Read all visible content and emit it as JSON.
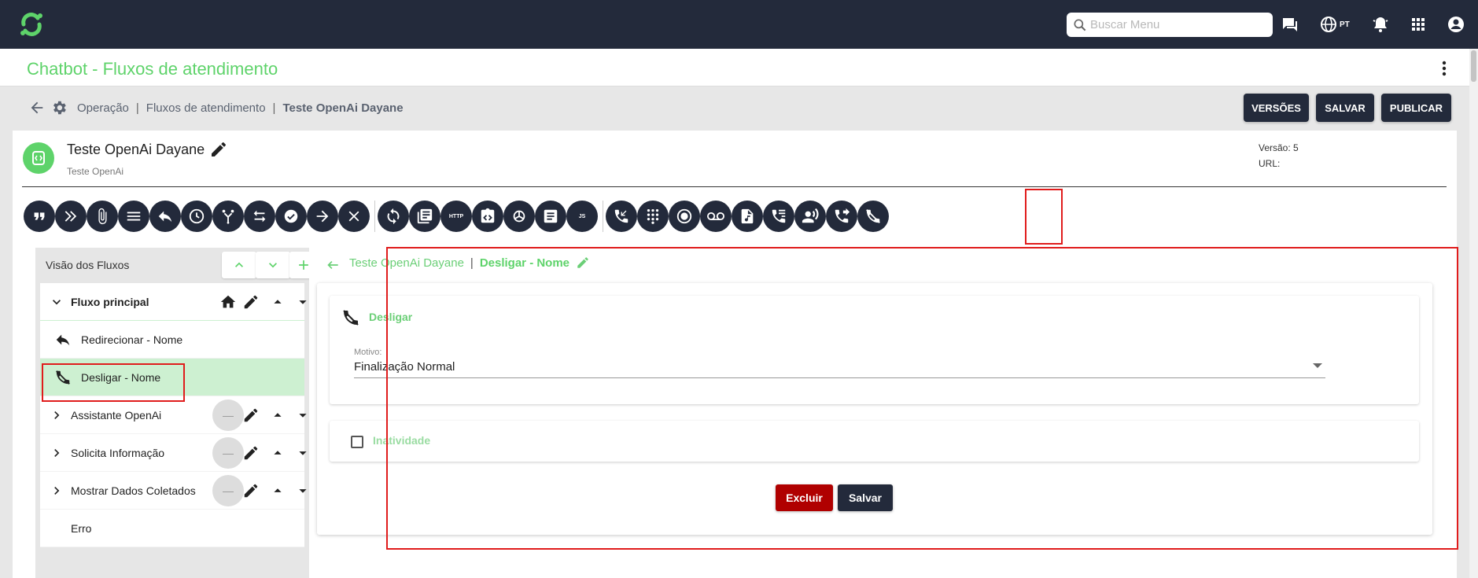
{
  "search": {
    "placeholder": "Buscar Menu"
  },
  "topnav": {
    "language": "PT"
  },
  "header": {
    "title": "Chatbot - Fluxos de atendimento"
  },
  "breadcrumb": {
    "items": [
      "Operação",
      "Fluxos de atendimento"
    ],
    "current": "Teste OpenAi Dayane"
  },
  "actions": {
    "versions": "VERSÕES",
    "save": "SALVAR",
    "publish": "PUBLICAR"
  },
  "flow": {
    "name": "Teste OpenAi Dayane",
    "description": "Teste OpenAi",
    "version_label": "Versão: 5",
    "url_label": "URL:"
  },
  "toolbar": {
    "http_label": "HTTP",
    "js_label": "JS",
    "icons": [
      "quote-icon",
      "forward-icon",
      "attachment-icon",
      "menu-icon",
      "reply-icon",
      "clock-icon",
      "branch-icon",
      "transfer-icon",
      "check-icon",
      "arrow-right-icon",
      "close-icon",
      "sync-icon",
      "library-icon",
      "http-icon",
      "code-icon",
      "openai-icon",
      "document-icon",
      "js-icon",
      "call-received-icon",
      "dialpad-icon",
      "record-icon",
      "voicemail-icon",
      "audio-file-icon",
      "phone-list-icon",
      "voice-icon",
      "phone-forward-icon",
      "hangup-icon"
    ]
  },
  "left_panel": {
    "title": "Visão dos Fluxos",
    "tree": [
      {
        "label": "Fluxo principal",
        "type": "group",
        "expanded": true
      },
      {
        "label": "Redirecionar - Nome",
        "type": "child"
      },
      {
        "label": "Desligar - Nome",
        "type": "child",
        "selected": true
      },
      {
        "label": "Assistante OpenAi",
        "type": "group"
      },
      {
        "label": "Solicita Informação",
        "type": "group"
      },
      {
        "label": "Mostrar Dados Coletados",
        "type": "group"
      },
      {
        "label": "Erro",
        "type": "plain"
      }
    ],
    "disc_symbol": "—"
  },
  "right_panel": {
    "breadcrumb_flow": "Teste OpenAi Dayane",
    "breadcrumb_sep": "|",
    "breadcrumb_node": "Desligar - Nome",
    "section_title": "Desligar",
    "field_label": "Motivo:",
    "field_value": "Finalização Normal",
    "checkbox_label": "Inatividade",
    "delete_label": "Excluir",
    "save_label": "Salvar"
  },
  "colors": {
    "navy": "#232a3b",
    "green": "#5ed36a",
    "selected_row": "#cdf0d1",
    "highlight": "#e01c1c",
    "danger": "#b00000"
  }
}
